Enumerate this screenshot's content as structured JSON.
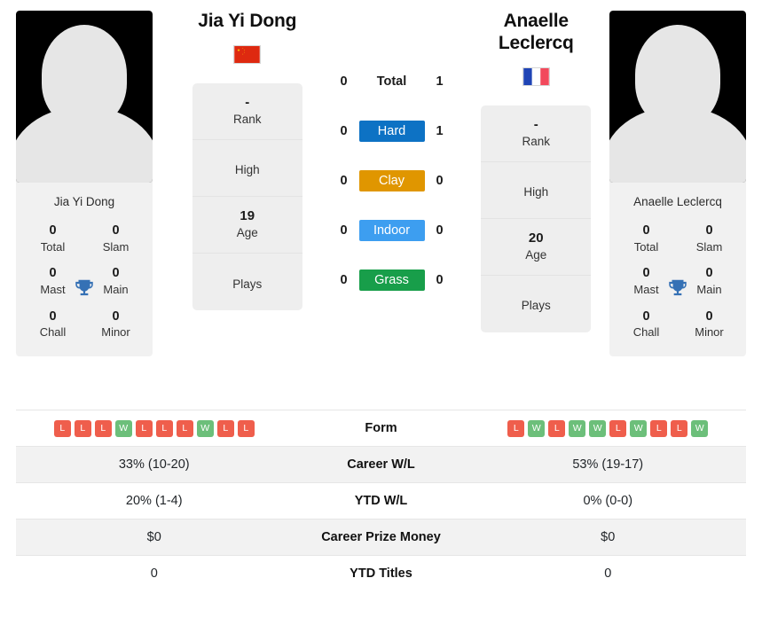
{
  "players": {
    "left": {
      "name": "Jia Yi Dong",
      "caption": "Jia Yi Dong",
      "flag": "china-flag",
      "rank": "-",
      "rank_label": "Rank",
      "high": "",
      "high_label": "High",
      "age": "19",
      "age_label": "Age",
      "plays": "",
      "plays_label": "Plays",
      "titles": [
        {
          "num": "0",
          "label": "Total"
        },
        {
          "num": "0",
          "label": "Slam"
        },
        {
          "num": "0",
          "label": "Mast"
        },
        {
          "num": "0",
          "label": "Main"
        },
        {
          "num": "0",
          "label": "Chall"
        },
        {
          "num": "0",
          "label": "Minor"
        }
      ],
      "form": [
        "L",
        "L",
        "L",
        "W",
        "L",
        "L",
        "L",
        "W",
        "L",
        "L"
      ],
      "career_wl": "33% (10-20)",
      "ytd_wl": "20% (1-4)",
      "career_prize": "$0",
      "ytd_titles": "0"
    },
    "right": {
      "name": "Anaelle Leclercq",
      "caption": "Anaelle Leclercq",
      "flag": "france-flag",
      "rank": "-",
      "rank_label": "Rank",
      "high": "",
      "high_label": "High",
      "age": "20",
      "age_label": "Age",
      "plays": "",
      "plays_label": "Plays",
      "titles": [
        {
          "num": "0",
          "label": "Total"
        },
        {
          "num": "0",
          "label": "Slam"
        },
        {
          "num": "0",
          "label": "Mast"
        },
        {
          "num": "0",
          "label": "Main"
        },
        {
          "num": "0",
          "label": "Chall"
        },
        {
          "num": "0",
          "label": "Minor"
        }
      ],
      "form": [
        "L",
        "W",
        "L",
        "W",
        "W",
        "L",
        "W",
        "L",
        "L",
        "W"
      ],
      "career_wl": "53% (19-17)",
      "ytd_wl": "0% (0-0)",
      "career_prize": "$0",
      "ytd_titles": "0"
    }
  },
  "head_to_head": [
    {
      "label": "Total",
      "left": "0",
      "right": "1",
      "color": "",
      "text_color": "#1b1b1b"
    },
    {
      "label": "Hard",
      "left": "0",
      "right": "1",
      "color": "#0d72c4",
      "text_color": "#ffffff"
    },
    {
      "label": "Clay",
      "left": "0",
      "right": "0",
      "color": "#e09600",
      "text_color": "#ffffff"
    },
    {
      "label": "Indoor",
      "left": "0",
      "right": "0",
      "color": "#3d9ef0",
      "text_color": "#ffffff"
    },
    {
      "label": "Grass",
      "left": "0",
      "right": "0",
      "color": "#189e4a",
      "text_color": "#ffffff"
    }
  ],
  "stat_rows": [
    {
      "label": "Form",
      "type": "form"
    },
    {
      "label": "Career W/L",
      "type": "text",
      "key": "career_wl"
    },
    {
      "label": "YTD W/L",
      "type": "text",
      "key": "ytd_wl"
    },
    {
      "label": "Career Prize Money",
      "type": "text",
      "key": "career_prize"
    },
    {
      "label": "YTD Titles",
      "type": "text",
      "key": "ytd_titles"
    }
  ],
  "colors": {
    "win_badge": "#6cbf7a",
    "loss_badge": "#ef5e4c",
    "trophy": "#3571b5",
    "panel_bg": "#eeeeee",
    "row_shade": "#f2f2f2"
  },
  "icons": {
    "trophy": "trophy-icon",
    "avatar": "avatar-silhouette-icon"
  }
}
